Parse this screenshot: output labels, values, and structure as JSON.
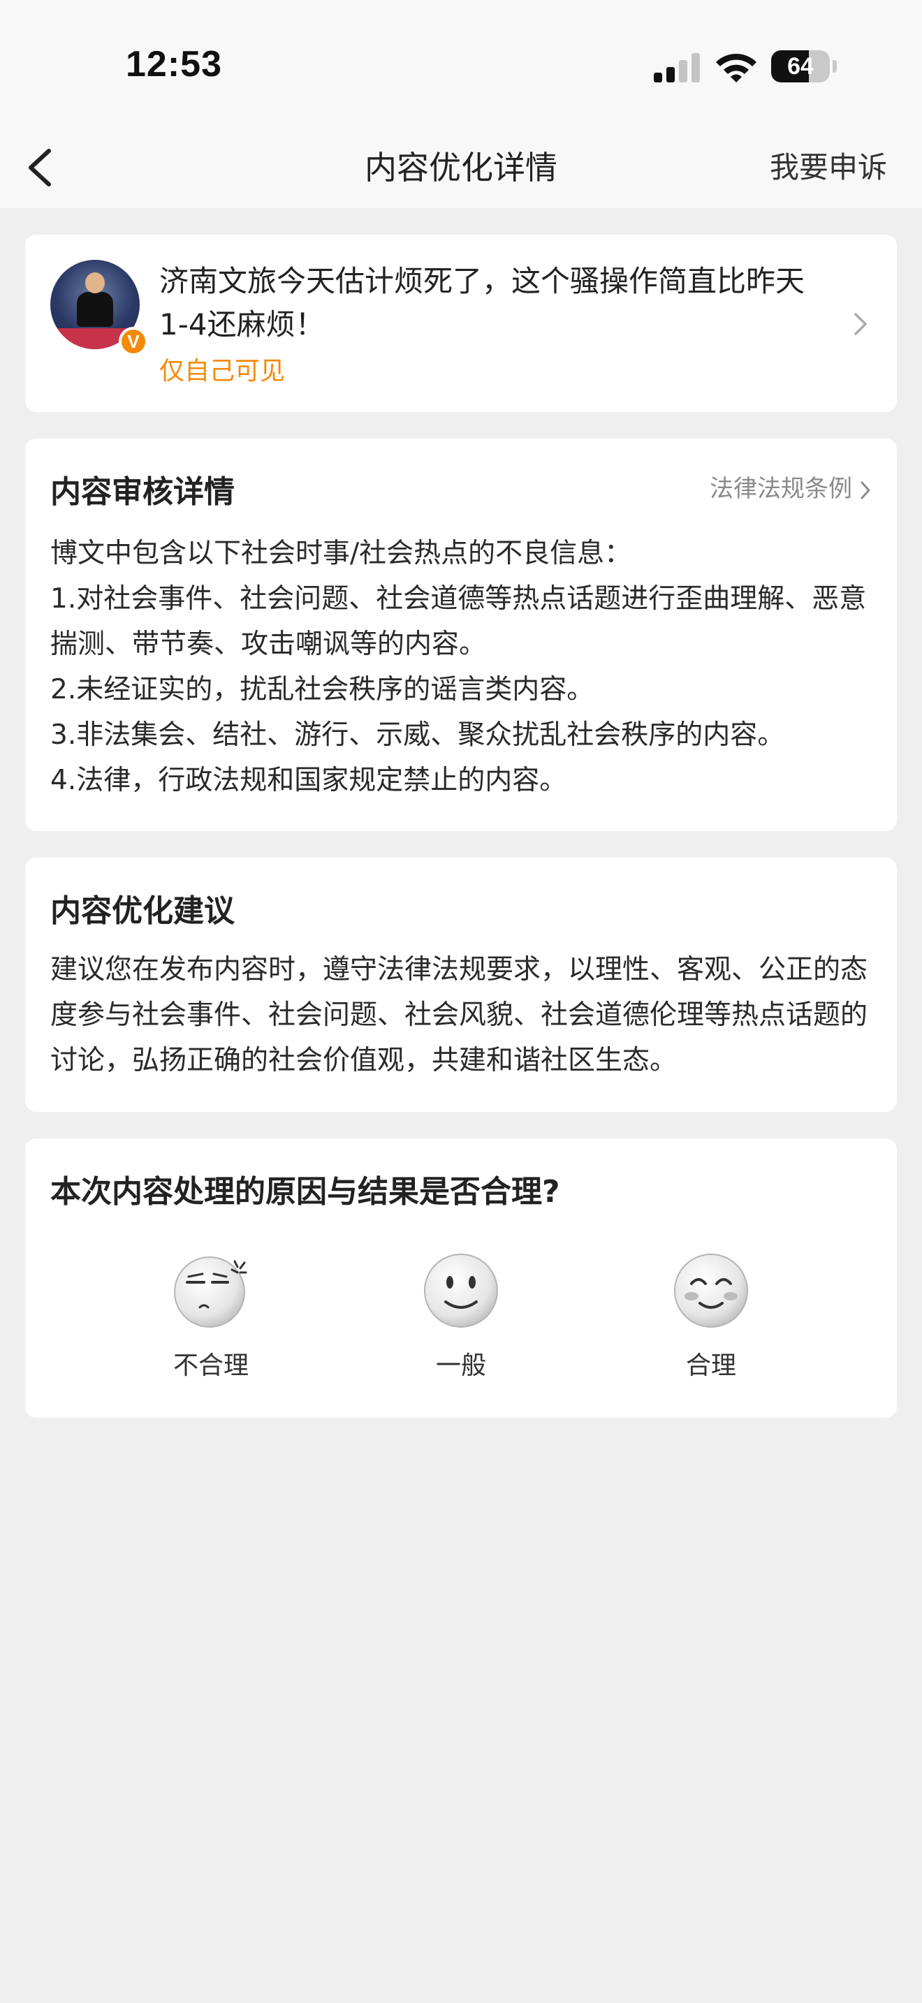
{
  "status_bar": {
    "time": "12:53",
    "battery_level": "64"
  },
  "nav": {
    "title": "内容优化详情",
    "appeal_label": "我要申诉"
  },
  "post": {
    "text": "济南文旅今天估计烦死了，这个骚操作简直比昨天1-4还麻烦！",
    "visibility": "仅自己可见",
    "badge": "V"
  },
  "review": {
    "title": "内容审核详情",
    "law_link_label": "法律法规条例",
    "intro": "博文中包含以下社会时事/社会热点的不良信息：",
    "items": [
      "1.对社会事件、社会问题、社会道德等热点话题进行歪曲理解、恶意揣测、带节奏、攻击嘲讽等的内容。",
      "2.未经证实的，扰乱社会秩序的谣言类内容。",
      "3.非法集会、结社、游行、示威、聚众扰乱社会秩序的内容。",
      "4.法律，行政法规和国家规定禁止的内容。"
    ]
  },
  "suggestion": {
    "title": "内容优化建议",
    "body": "建议您在发布内容时，遵守法律法规要求，以理性、客观、公正的态度参与社会事件、社会问题、社会风貌、社会道德伦理等热点话题的讨论，弘扬正确的社会价值观，共建和谐社区生态。"
  },
  "feedback": {
    "question": "本次内容处理的原因与结果是否合理?",
    "options": [
      {
        "label": "不合理",
        "icon": "annoyed-face-icon"
      },
      {
        "label": "一般",
        "icon": "neutral-smile-face-icon"
      },
      {
        "label": "合理",
        "icon": "happy-blush-face-icon"
      }
    ]
  },
  "colors": {
    "accent_orange": "#f5890a",
    "background": "#efefef",
    "card": "#ffffff",
    "muted_text": "#8a8a8a"
  }
}
